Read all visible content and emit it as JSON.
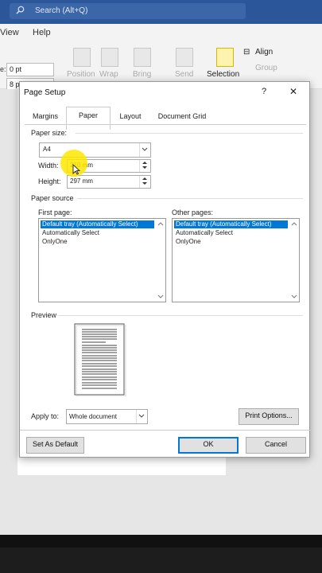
{
  "search": {
    "text": "Search (Alt+Q)"
  },
  "menu": {
    "view": "View",
    "help": "Help"
  },
  "ribbon": {
    "spacing_before": "0 pt",
    "spacing_after": "8 p",
    "prefix_label": "e:",
    "position": "Position",
    "wrap": "Wrap",
    "bring": "Bring",
    "send": "Send",
    "selection": "Selection",
    "align": "Align",
    "group": "Group"
  },
  "dialog": {
    "title": "Page Setup",
    "help": "?",
    "close": "✕",
    "tabs": [
      "Margins",
      "Paper",
      "Layout",
      "Document Grid"
    ],
    "paper_size_label": "Paper size:",
    "paper_size_value": "A4",
    "width_label": "Width:",
    "width_value": "210 mm",
    "height_label": "Height:",
    "height_value": "297 mm",
    "paper_source_label": "Paper source",
    "first_page_label": "First page:",
    "other_pages_label": "Other pages:",
    "first_page_items": [
      "Default tray (Automatically Select)",
      "Automatically Select",
      "OnlyOne"
    ],
    "other_pages_items": [
      "Default tray (Automatically Select)",
      "Automatically Select",
      "OnlyOne"
    ],
    "preview_label": "Preview",
    "apply_to_label": "Apply to:",
    "apply_to_value": "Whole document",
    "print_options": "Print Options...",
    "set_default": "Set As Default",
    "ok": "OK",
    "cancel": "Cancel"
  },
  "colors": {
    "titlebar": "#2b579a",
    "selection": "#0078d7",
    "highlight": "#ffe600"
  }
}
